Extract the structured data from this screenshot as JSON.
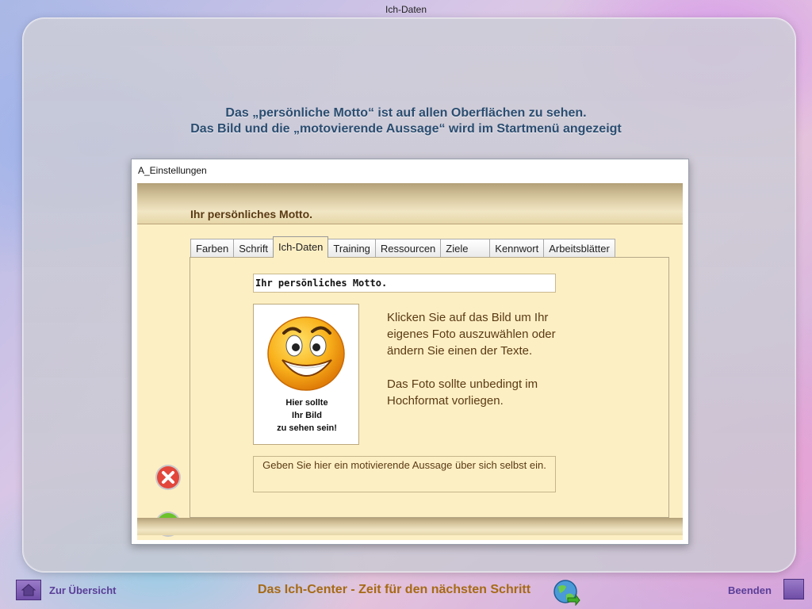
{
  "window": {
    "title": "Ich-Daten"
  },
  "headline": {
    "line1": "Das  „persönliche Motto“ ist auf allen Oberflächen zu sehen.",
    "line2": "Das Bild und die „motovierende Aussage“ wird im Startmenü angezeigt"
  },
  "dialog": {
    "title": "A_Einstellungen",
    "heading": "Ihr persönliches Motto.",
    "tabs": [
      "Farben",
      "Schrift",
      "Ich-Daten",
      "Training",
      "Ressourcen",
      "Ziele",
      "Kennwort",
      "Arbeitsblätter"
    ],
    "active_tab": "Ich-Daten",
    "motto_value": "Ihr persönliches Motto.",
    "photo_caption": [
      "Hier sollte",
      "Ihr Bild",
      "zu sehen sein!"
    ],
    "help_text": {
      "line1": "Klicken Sie auf das Bild um Ihr",
      "line2": "eigenes Foto auszuwählen oder",
      "line3": "ändern Sie einen der Texte.",
      "line4": "Das Foto sollte unbedingt im",
      "line5": "Hochformat vorliegen."
    },
    "statement_value": "Geben Sie hier ein motivierende Aussage über sich selbst ein."
  },
  "footer": {
    "overview_label": "Zur Übersicht",
    "center_title": "Das Ich-Center - Zeit für den nächsten Schritt",
    "exit_label": "Beenden"
  },
  "colors": {
    "headline": "#2a4d70",
    "dialog_bg": "#fdefc4",
    "brown_text": "#5a3a14",
    "footer_link": "#5a3e98",
    "footer_title": "#a66a14",
    "cancel": "#e3463b",
    "ok": "#6cc22a"
  },
  "icons": {
    "cancel": "close-circle-icon",
    "ok": "checkmark-circle-icon",
    "home": "home-icon",
    "globe": "globe-arrow-icon",
    "smiley": "smiley-icon"
  }
}
